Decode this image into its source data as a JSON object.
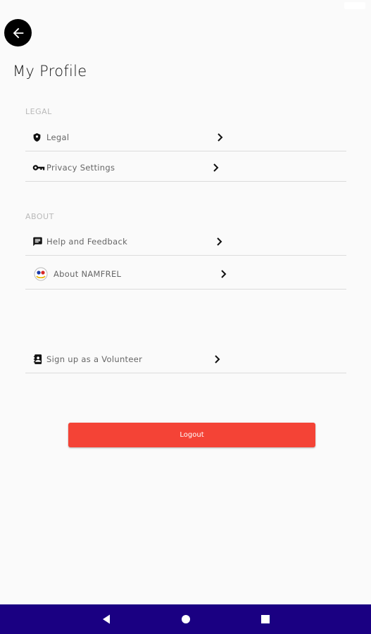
{
  "header": {
    "title": "My Profile",
    "back_icon": "arrow-left-icon"
  },
  "sections": {
    "legal": {
      "label": "LEGAL",
      "items": [
        {
          "label": "Legal",
          "icon": "shield-icon"
        },
        {
          "label": "Privacy Settings",
          "icon": "key-icon"
        }
      ]
    },
    "about": {
      "label": "ABOUT",
      "items": [
        {
          "label": "Help and Feedback",
          "icon": "feedback-icon"
        },
        {
          "label": "About NAMFREL",
          "icon": "namfrel-logo-icon"
        }
      ]
    },
    "volunteer": {
      "items": [
        {
          "label": "Sign up as a Volunteer",
          "icon": "contact-book-icon"
        }
      ]
    }
  },
  "logout": {
    "label": "Logout",
    "color": "#f44336"
  },
  "navigation": {
    "color": "#1a0082",
    "buttons": [
      "back-icon",
      "home-icon",
      "recents-icon"
    ]
  }
}
